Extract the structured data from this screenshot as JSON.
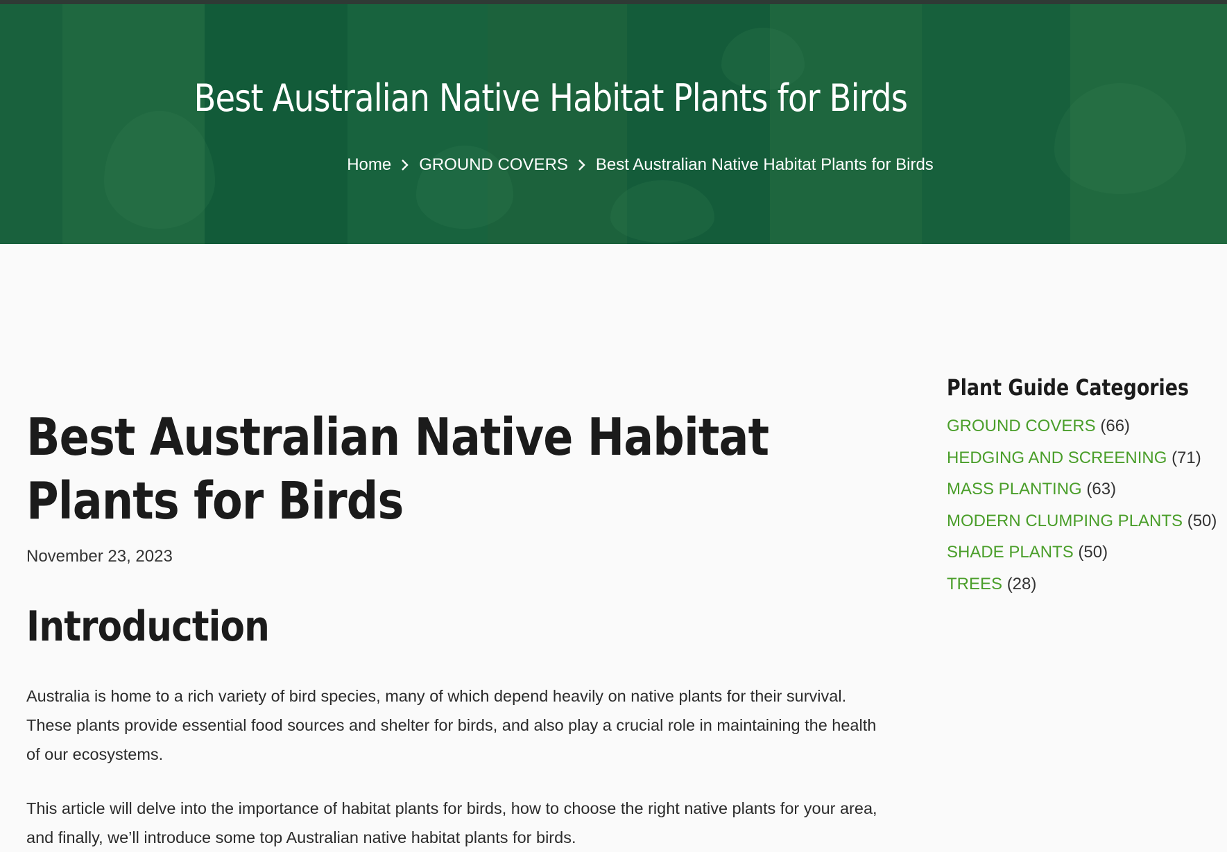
{
  "hero": {
    "title": "Best Australian Native Habitat Plants for Birds",
    "breadcrumb": [
      {
        "label": "Home"
      },
      {
        "label": "GROUND COVERS"
      },
      {
        "label": "Best Australian Native Habitat Plants for Birds"
      }
    ],
    "separator_icon": "chevron-right-icon"
  },
  "post": {
    "title": "Best Australian Native Habitat Plants for Birds",
    "date": "November 23, 2023",
    "section_heading": "Introduction",
    "paragraphs": [
      "Australia is home to a rich variety of bird species, many of which depend heavily on native plants for their survival. These plants provide essential food sources and shelter for birds, and also play a crucial role in maintaining the health of our ecosystems.",
      "This article will delve into the importance of habitat plants for birds, how to choose the right native plants for your area, and finally, we’ll introduce some top Australian native habitat plants for birds."
    ]
  },
  "sidebar": {
    "title": "Plant Guide Categories",
    "categories": [
      {
        "label": "GROUND COVERS",
        "count": "(66)"
      },
      {
        "label": "HEDGING AND SCREENING",
        "count": "(71)"
      },
      {
        "label": "MASS PLANTING",
        "count": "(63)"
      },
      {
        "label": "MODERN CLUMPING PLANTS",
        "count": "(50)"
      },
      {
        "label": "SHADE PLANTS",
        "count": "(50)"
      },
      {
        "label": "TREES",
        "count": "(28)"
      }
    ]
  },
  "colors": {
    "hero_green": "#0f5a3a",
    "link_green": "#4a9e2a",
    "heading": "#1b1b1b",
    "background": "#fafafa"
  }
}
